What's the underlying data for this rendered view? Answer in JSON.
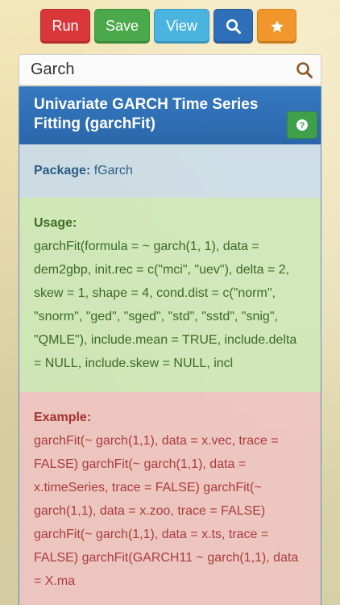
{
  "toolbar": {
    "run_label": "Run",
    "save_label": "Save",
    "view_label": "View",
    "search_icon": "search-icon",
    "star_icon": "star-icon",
    "colors": {
      "run": "#d9373a",
      "save": "#4aa94a",
      "view": "#4bb3e0",
      "search": "#2f6fb7",
      "star": "#f0962b"
    }
  },
  "search": {
    "value": "Garch",
    "icon": "search-icon"
  },
  "card": {
    "title": "Univariate GARCH Time Series Fitting (garchFit)",
    "help_icon": "question-icon",
    "package": {
      "label": "Package:",
      "value": "fGarch"
    },
    "usage": {
      "label": "Usage:",
      "text": "garchFit(formula = ~ garch(1, 1), data = dem2gbp, init.rec = c(\"mci\", \"uev\"), delta = 2, skew = 1, shape = 4, cond.dist = c(\"norm\", \"snorm\", \"ged\", \"sged\", \"std\", \"sstd\", \"snig\", \"QMLE\"), include.mean = TRUE, include.delta = NULL, include.skew = NULL, incl"
    },
    "example": {
      "label": "Example:",
      "text": "garchFit(~ garch(1,1), data = x.vec, trace = FALSE) garchFit(~ garch(1,1), data = x.timeSeries, trace = FALSE) garchFit(~ garch(1,1), data = x.zoo, trace = FALSE) garchFit(~ garch(1,1), data = x.ts, trace = FALSE) garchFit(GARCH11 ~ garch(1,1), data = X.ma"
    }
  }
}
